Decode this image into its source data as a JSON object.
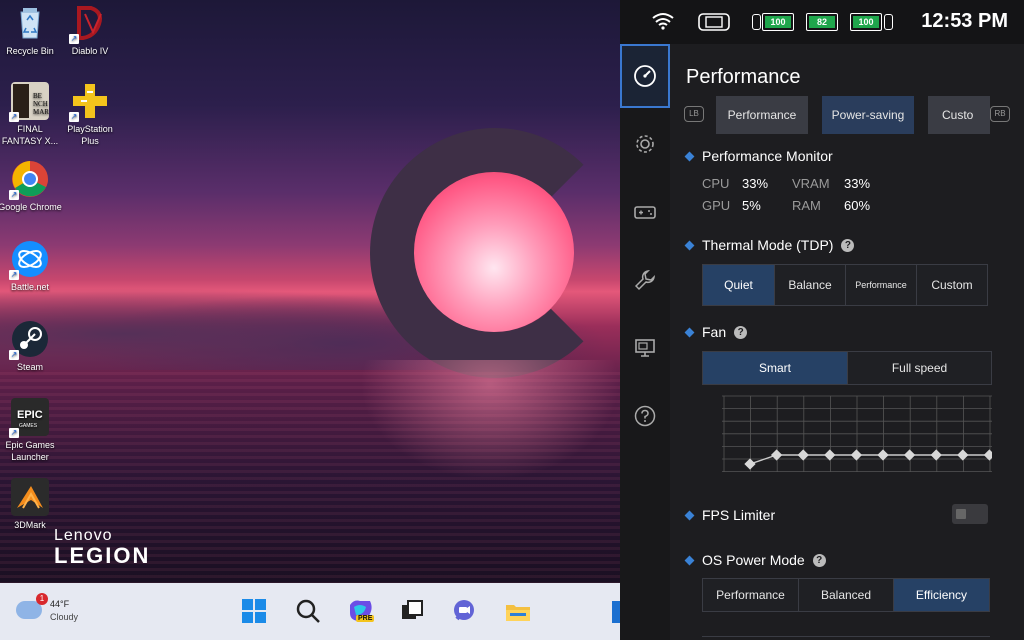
{
  "desktop": {
    "icons": [
      {
        "label": "Recycle Bin"
      },
      {
        "label": "Diablo IV"
      },
      {
        "label": "FINAL FANTASY X..."
      },
      {
        "label": "PlayStation Plus"
      },
      {
        "label": "Google Chrome"
      },
      {
        "label": "Battle.net"
      },
      {
        "label": "Steam"
      },
      {
        "label": "Epic Games Launcher"
      },
      {
        "label": "3DMark"
      }
    ],
    "logo_line1": "Lenovo",
    "logo_line2": "LEGION"
  },
  "taskbar": {
    "weather": {
      "badge": "1",
      "temp": "44°F",
      "condition": "Cloudy"
    },
    "buttons": [
      "start",
      "search",
      "copilot",
      "task-view",
      "teams",
      "file-explorer"
    ],
    "copilot_badge": "PRE"
  },
  "status_bar": {
    "time": "12:53 PM",
    "batteries": [
      "100",
      "82",
      "100"
    ]
  },
  "panel": {
    "title": "Performance",
    "lb_label": "LB",
    "rb_label": "RB",
    "mode_tabs": [
      "Performance",
      "Power-saving",
      "Custo"
    ],
    "active_mode": 1,
    "monitor": {
      "title": "Performance Monitor",
      "cpu_label": "CPU",
      "cpu_value": "33%",
      "gpu_label": "GPU",
      "gpu_value": "5%",
      "vram_label": "VRAM",
      "vram_value": "33%",
      "ram_label": "RAM",
      "ram_value": "60%"
    },
    "thermal": {
      "title": "Thermal Mode (TDP)",
      "options": [
        "Quiet",
        "Balance",
        "Performance",
        "Custom"
      ],
      "active": 0
    },
    "fan": {
      "title": "Fan",
      "options": [
        "Smart",
        "Full speed"
      ],
      "active": 0,
      "curve_points": 10
    },
    "fps": {
      "title": "FPS Limiter",
      "enabled": false
    },
    "os_power": {
      "title": "OS Power Mode",
      "options": [
        "Performance",
        "Balanced",
        "Efficiency"
      ],
      "active": 2
    }
  },
  "colors": {
    "accent": "#3a82d6",
    "active_tab": "#264165",
    "battery_green": "#1fa64c"
  }
}
